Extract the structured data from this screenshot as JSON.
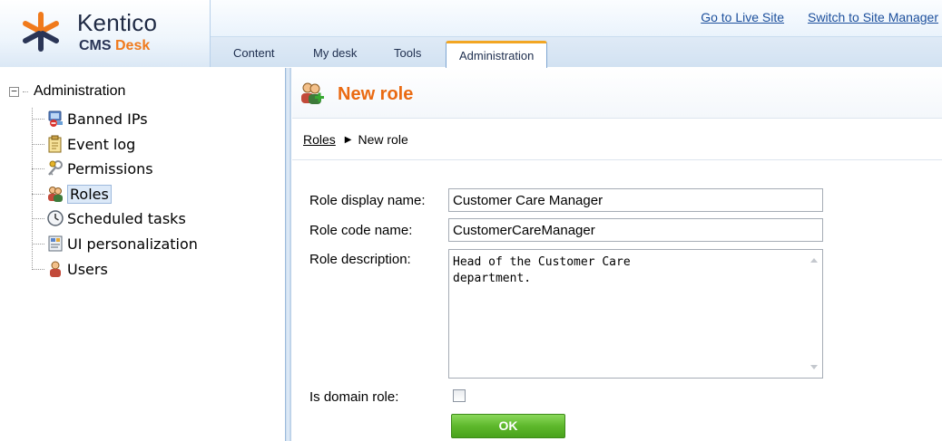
{
  "header": {
    "logo_name": "Kentico",
    "logo_sub_prefix": "CMS ",
    "logo_sub_accent": "Desk",
    "links": {
      "live_site": "Go to Live Site",
      "site_manager": "Switch to Site Manager"
    },
    "tabs": [
      "Content",
      "My desk",
      "Tools",
      "Administration"
    ],
    "active_tab": "Administration"
  },
  "tree": {
    "root": "Administration",
    "items": [
      {
        "label": "Banned IPs",
        "icon": "banned-ips-icon"
      },
      {
        "label": "Event log",
        "icon": "event-log-icon"
      },
      {
        "label": "Permissions",
        "icon": "permissions-icon"
      },
      {
        "label": "Roles",
        "icon": "roles-icon"
      },
      {
        "label": "Scheduled tasks",
        "icon": "scheduled-tasks-icon"
      },
      {
        "label": "UI personalization",
        "icon": "ui-personalization-icon"
      },
      {
        "label": "Users",
        "icon": "users-icon"
      }
    ],
    "selected": "Roles"
  },
  "page": {
    "title": "New role",
    "breadcrumb": {
      "parent": "Roles",
      "current": "New role"
    }
  },
  "form": {
    "display_name": {
      "label": "Role display name:",
      "value": "Customer Care Manager"
    },
    "code_name": {
      "label": "Role code name:",
      "value": "CustomerCareManager"
    },
    "description": {
      "label": "Role description:",
      "value": "Head of the Customer Care\ndepartment."
    },
    "domain_role": {
      "label": "Is domain role:",
      "checked": false
    },
    "ok_label": "OK"
  },
  "colors": {
    "title": "#ea6a12",
    "ok_button": "#5eb82c",
    "tab_accent": "#f2a623",
    "link": "#1c4f9c"
  }
}
